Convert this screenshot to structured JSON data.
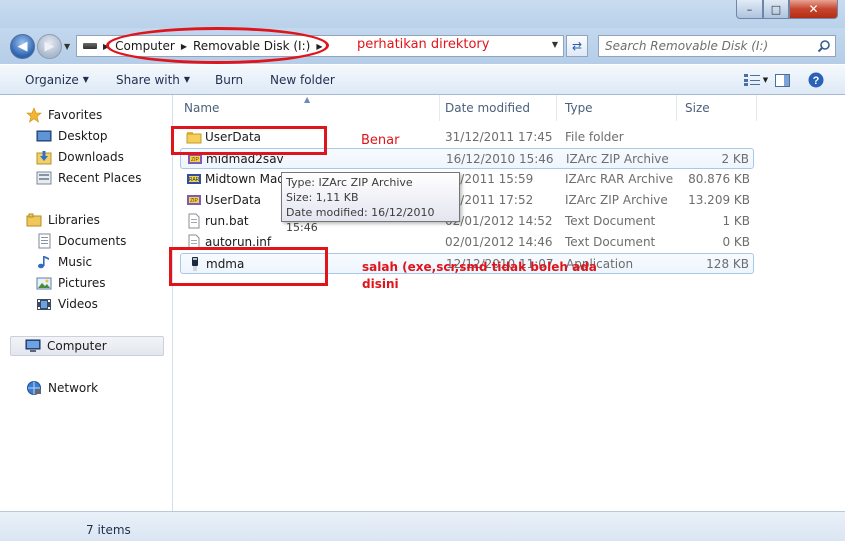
{
  "window": {
    "minimize_glyph": "–",
    "maximize_glyph": "□",
    "close_glyph": "✕"
  },
  "address": {
    "crumbs": [
      "Computer",
      "Removable Disk (I:)"
    ],
    "search_placeholder": "Search Removable Disk (I:)"
  },
  "toolbar": {
    "organize": "Organize",
    "share_with": "Share with",
    "burn": "Burn",
    "new_folder": "New folder"
  },
  "nav": {
    "favorites": "Favorites",
    "desktop": "Desktop",
    "downloads": "Downloads",
    "recent_places": "Recent Places",
    "libraries": "Libraries",
    "documents": "Documents",
    "music": "Music",
    "pictures": "Pictures",
    "videos": "Videos",
    "computer": "Computer",
    "network": "Network"
  },
  "columns": {
    "name": "Name",
    "date": "Date modified",
    "type": "Type",
    "size": "Size"
  },
  "files": [
    {
      "name": "UserData",
      "date": "31/12/2011 17:45",
      "type": "File folder",
      "size": "",
      "icon": "folder-icon"
    },
    {
      "name": "midmad2sav",
      "date": "16/12/2010 15:46",
      "type": "IZArc ZIP Archive",
      "size": "2 KB",
      "icon": "zip-archive-icon"
    },
    {
      "name": "Midtown Mad",
      "date": "01/2011 15:59",
      "type": "IZArc RAR Archive",
      "size": "80.876 KB",
      "icon": "rar-archive-icon"
    },
    {
      "name": "UserData",
      "date": "12/2011 17:52",
      "type": "IZArc ZIP Archive",
      "size": "13.209 KB",
      "icon": "zip-archive-icon"
    },
    {
      "name": "run.bat",
      "date": "02/01/2012 14:52",
      "type": "Text Document",
      "size": "1 KB",
      "icon": "text-file-icon"
    },
    {
      "name": "autorun.inf",
      "date": "02/01/2012 14:46",
      "type": "Text Document",
      "size": "0 KB",
      "icon": "text-file-icon"
    },
    {
      "name": "mdma",
      "date": "12/12/2010 11:07",
      "type": "Application",
      "size": "128 KB",
      "icon": "application-icon"
    }
  ],
  "tooltip": {
    "type": "Type: IZArc ZIP Archive",
    "size": "Size: 1,11 KB",
    "modified": "Date modified: 16/12/2010 15:46"
  },
  "annotations": {
    "directory": "perhatikan direktory",
    "correct": "Benar",
    "wrong_line1": "salah (exe,scr,smd tidak boleh ada",
    "wrong_line2": "disini"
  },
  "status": {
    "items": "7 items"
  },
  "colors": {
    "annotation_red": "#e0141b"
  }
}
